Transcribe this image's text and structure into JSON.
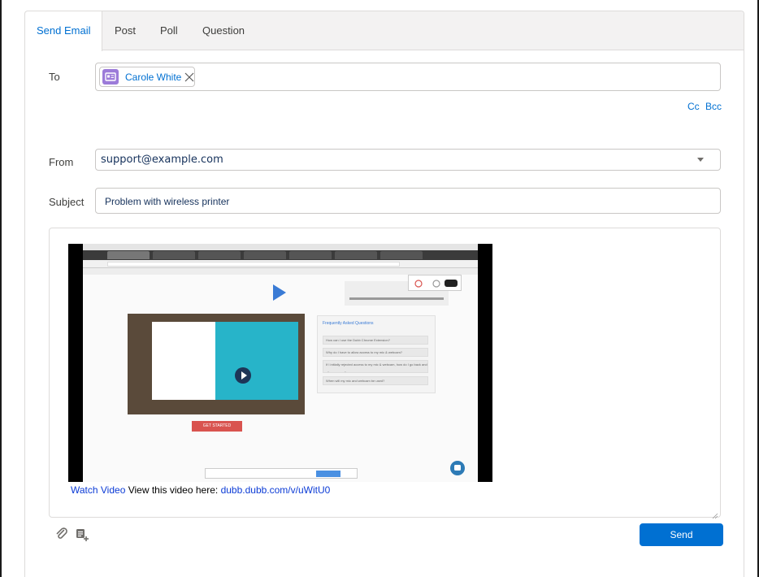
{
  "tabs": [
    {
      "label": "Send Email",
      "active": true
    },
    {
      "label": "Post"
    },
    {
      "label": "Poll"
    },
    {
      "label": "Question"
    }
  ],
  "to": {
    "label": "To",
    "recipient": "Carole White",
    "recipient_icon": "contact-card-icon",
    "cc_label": "Cc",
    "bcc_label": "Bcc"
  },
  "from": {
    "label": "From",
    "value": "support@example.com"
  },
  "subject": {
    "label": "Subject",
    "value": "Problem with wireless printer"
  },
  "body": {
    "watch_link": "Watch Video",
    "text": " View this video here: ",
    "video_link": "dubb.dubb.com/v/uWitU0",
    "video_thumbnail": {
      "get_started": "GET STARTED",
      "faq_title": "Frequently Asked Questions",
      "faq_items": [
        "How can I use the Dubb Chrome Extension?",
        "Why do I have to allow access to my mic & webcam?",
        "If I initially rejected access to my mic & webcam, how do I go back and allow access?",
        "When will my mic and webcam be used?"
      ]
    }
  },
  "toolbar": {
    "attach_icon": "paperclip-icon",
    "template_icon": "insert-template-icon",
    "send_label": "Send"
  },
  "colors": {
    "accent": "#0070d2",
    "avatar": "#9c7bd9",
    "border": "#dddbda"
  }
}
